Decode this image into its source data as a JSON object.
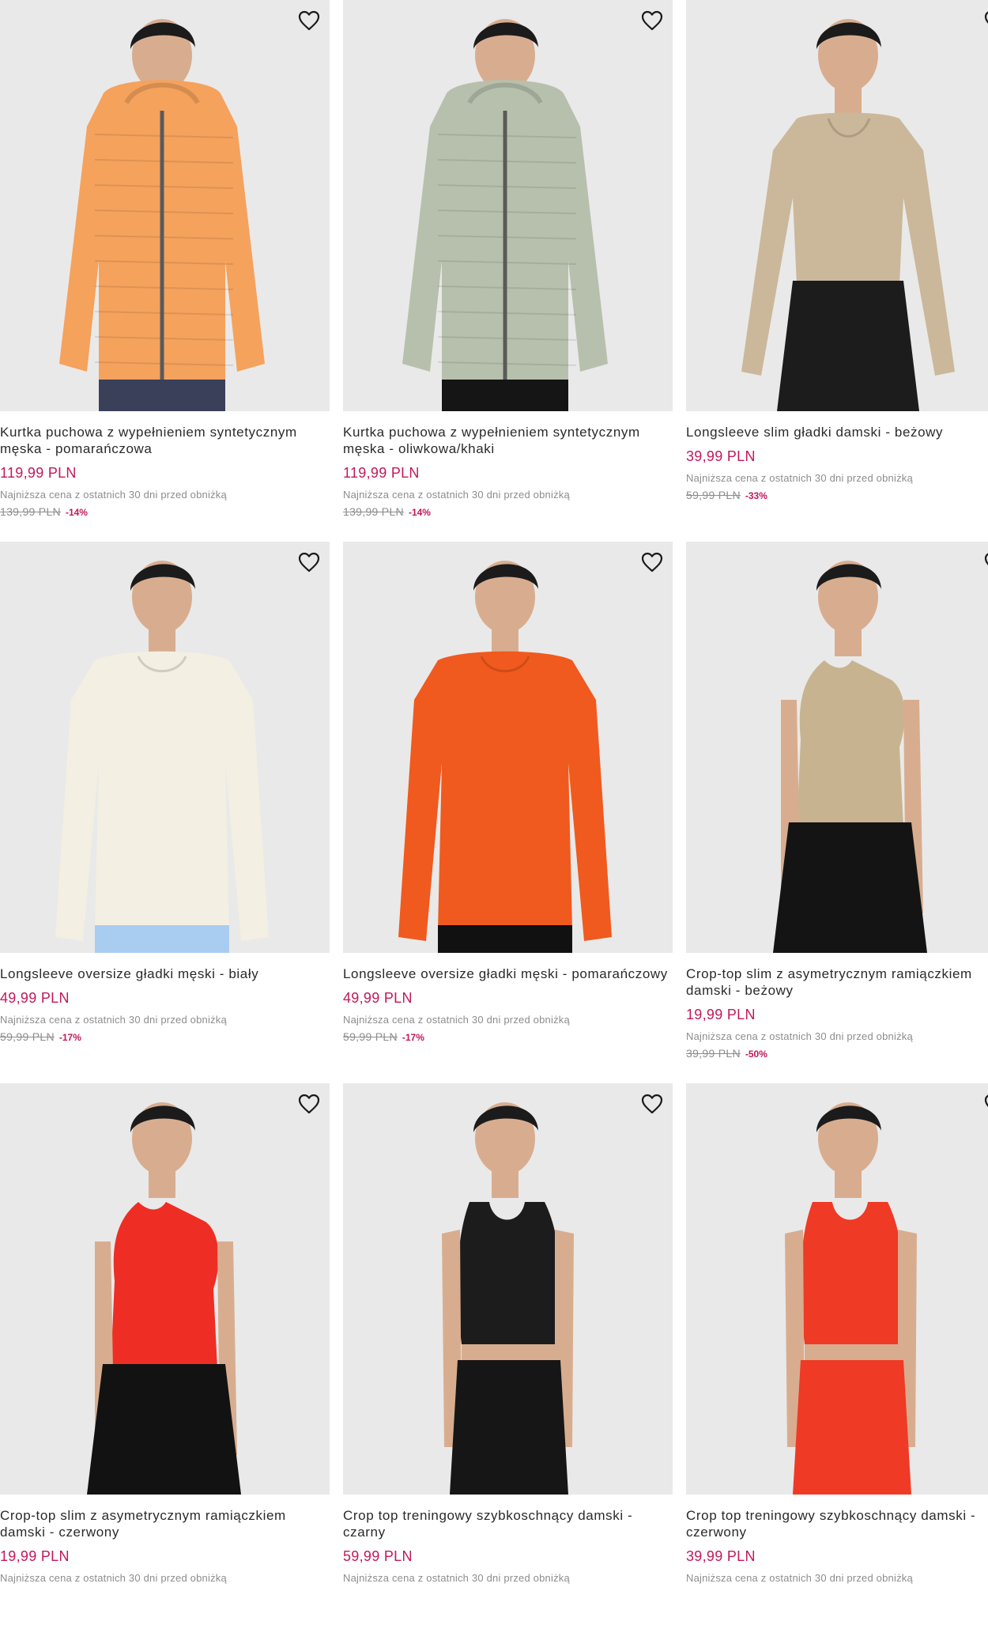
{
  "accent_color": "#c2185b",
  "icons": {
    "wishlist": "heart-outline-icon"
  },
  "products": [
    {
      "name": "Kurtka puchowa z wypełnieniem syntetycznym męska - pomarańczowa",
      "price": "119,99 PLN",
      "lowest_label": "Najniższa cena z ostatnich 30 dni przed obniżką",
      "old_price": "139,99 PLN",
      "discount": "-14%",
      "colors": {
        "top": "#f5a25d",
        "bottom": "#3a3f5a",
        "bg": "#e9e9e9"
      },
      "kind": "jacket"
    },
    {
      "name": "Kurtka puchowa z wypełnieniem syntetycznym męska - oliwkowa/khaki",
      "price": "119,99 PLN",
      "lowest_label": "Najniższa cena z ostatnich 30 dni przed obniżką",
      "old_price": "139,99 PLN",
      "discount": "-14%",
      "colors": {
        "top": "#b7c0ad",
        "bottom": "#151515",
        "bg": "#e9e9e9"
      },
      "kind": "jacket"
    },
    {
      "name": "Longsleeve slim gładki damski - beżowy",
      "price": "39,99 PLN",
      "lowest_label": "Najniższa cena z ostatnich 30 dni przed obniżką",
      "old_price": "59,99 PLN",
      "discount": "-33%",
      "colors": {
        "top": "#cbb79a",
        "bottom": "#1c1c1c",
        "bg": "#e9e9e9"
      },
      "kind": "longsleeve-w"
    },
    {
      "name": "Longsleeve oversize gładki męski - biały",
      "price": "49,99 PLN",
      "lowest_label": "Najniższa cena z ostatnich 30 dni przed obniżką",
      "old_price": "59,99 PLN",
      "discount": "-17%",
      "colors": {
        "top": "#f3efe2",
        "bottom": "#a9cdf0",
        "bg": "#e9e9e9"
      },
      "kind": "longsleeve-m"
    },
    {
      "name": "Longsleeve oversize gładki męski - pomarańczowy",
      "price": "49,99 PLN",
      "lowest_label": "Najniższa cena z ostatnich 30 dni przed obniżką",
      "old_price": "59,99 PLN",
      "discount": "-17%",
      "colors": {
        "top": "#f05a1e",
        "bottom": "#111111",
        "bg": "#e9e9e9"
      },
      "kind": "longsleeve-m"
    },
    {
      "name": "Crop-top slim z asymetrycznym ramiączkiem damski - beżowy",
      "price": "19,99 PLN",
      "lowest_label": "Najniższa cena z ostatnich 30 dni przed obniżką",
      "old_price": "39,99 PLN",
      "discount": "-50%",
      "colors": {
        "top": "#c8b391",
        "bottom": "#141414",
        "bg": "#e9e9e9"
      },
      "kind": "croptop"
    },
    {
      "name": "Crop-top slim z asymetrycznym ramiączkiem damski - czerwony",
      "price": "19,99 PLN",
      "lowest_label": "Najniższa cena z ostatnich 30 dni przed obniżką",
      "old_price": "",
      "discount": "",
      "colors": {
        "top": "#ee2e24",
        "bottom": "#121212",
        "bg": "#e9e9e9"
      },
      "kind": "croptop"
    },
    {
      "name": "Crop top treningowy szybkoschnący damski - czarny",
      "price": "59,99 PLN",
      "lowest_label": "Najniższa cena z ostatnich 30 dni przed obniżką",
      "old_price": "",
      "discount": "",
      "colors": {
        "top": "#1c1c1c",
        "bottom": "#161616",
        "bg": "#e9e9e9"
      },
      "kind": "tank"
    },
    {
      "name": "Crop top treningowy szybkoschnący damski - czerwony",
      "price": "39,99 PLN",
      "lowest_label": "Najniższa cena z ostatnich 30 dni przed obniżką",
      "old_price": "",
      "discount": "",
      "colors": {
        "top": "#ef3a25",
        "bottom": "#ef3a25",
        "bg": "#e9e9e9"
      },
      "kind": "tank"
    }
  ]
}
